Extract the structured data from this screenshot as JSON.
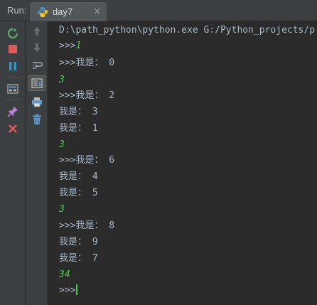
{
  "panel": {
    "run_label": "Run:"
  },
  "tab": {
    "label": "day7",
    "close": "×"
  },
  "colors": {
    "input_green": "#4ec94e",
    "text": "#a9b7c6",
    "background": "#2b2b2b",
    "toolbar": "#3c3f41"
  },
  "icons": {
    "left_toolbar": [
      "rerun-icon",
      "stop-icon",
      "pause-icon",
      "print-layout-icon",
      "pin-icon",
      "close-icon"
    ],
    "second_toolbar": [
      "arrow-up-icon",
      "arrow-down-icon",
      "soft-wrap-icon",
      "scroll-to-end-icon",
      "print-icon",
      "trash-icon"
    ]
  },
  "console": {
    "command": "D:\\path_python\\python.exe G:/Python_projects/p",
    "lines": [
      {
        "kind": "prompt-input",
        "prompt": ">>>",
        "text": "1"
      },
      {
        "kind": "prompt-output",
        "prompt": ">>>",
        "text": "我是： 0"
      },
      {
        "kind": "input",
        "text": "3"
      },
      {
        "kind": "prompt-output",
        "prompt": ">>>",
        "text": "我是： 2"
      },
      {
        "kind": "output",
        "text": "我是： 3"
      },
      {
        "kind": "output",
        "text": "我是： 1"
      },
      {
        "kind": "input",
        "text": "3"
      },
      {
        "kind": "prompt-output",
        "prompt": ">>>",
        "text": "我是： 6"
      },
      {
        "kind": "output",
        "text": "我是： 4"
      },
      {
        "kind": "output",
        "text": "我是： 5"
      },
      {
        "kind": "input",
        "text": "3"
      },
      {
        "kind": "prompt-output",
        "prompt": ">>>",
        "text": "我是： 8"
      },
      {
        "kind": "output",
        "text": "我是： 9"
      },
      {
        "kind": "output",
        "text": "我是： 7"
      },
      {
        "kind": "input",
        "text": "34"
      },
      {
        "kind": "prompt-cursor",
        "prompt": ">>>",
        "text": ""
      }
    ]
  }
}
